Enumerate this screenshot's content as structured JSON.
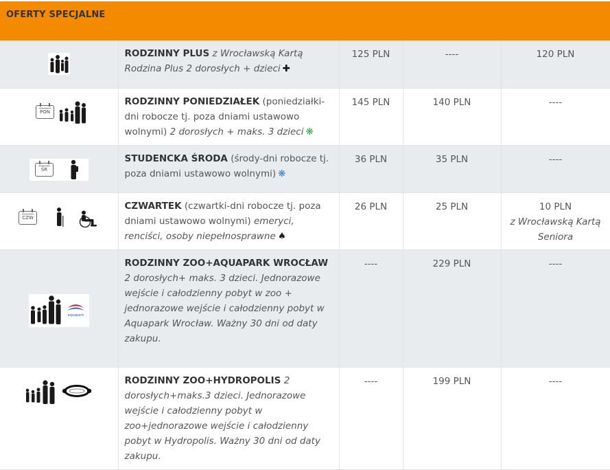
{
  "header": {
    "title": "OFERTY SPECJALNE"
  },
  "colors": {
    "header_bg": "#f38a00",
    "row_gray": "#e9ecef",
    "green_symbol": "#3aa74a",
    "blue_symbol": "#3b82c4"
  },
  "offers": [
    {
      "icons": [
        "family-silhouette-icon"
      ],
      "name": "RODZINNY PLUS",
      "rest": "",
      "italic": "z Wrocławską Kartą Rodzina Plus 2 dorosłych + dzieci",
      "symbol": "✚",
      "price1": "125 PLN",
      "price2": "----",
      "price3": "120 PLN",
      "price3_note": ""
    },
    {
      "icons": [
        "calendar-icon",
        "family-silhouette-icon"
      ],
      "calendar_label": "PON",
      "name": "RODZINNY PONIEDZIAŁEK",
      "rest": "(poniedziałki-dni robocze tj. poza dniami ustawowo wolnymi)",
      "italic": "2 dorosłych + maks. 3 dzieci",
      "symbol": "❋",
      "price1": "145 PLN",
      "price2": "140 PLN",
      "price3": "----",
      "price3_note": ""
    },
    {
      "icons": [
        "calendar-icon",
        "student-silhouette-icon"
      ],
      "calendar_label": "ŚR",
      "name": "STUDENCKA ŚRODA",
      "rest": "(środy-dni robocze tj. poza dniami ustawowo wolnymi)",
      "italic": "",
      "symbol": "❋",
      "price1": "36 PLN",
      "price2": "35 PLN",
      "price3": "----",
      "price3_note": ""
    },
    {
      "icons": [
        "calendar-icon",
        "senior-silhouette-icon",
        "wheelchair-icon"
      ],
      "calendar_label": "CZW",
      "name": "CZWARTEK",
      "rest": "(czwartki-dni robocze tj. poza dniami ustawowo wolnymi)",
      "italic": "emeryci, renciści, osoby niepełnosprawne",
      "symbol": "♠",
      "price1": "26 PLN",
      "price2": "25 PLN",
      "price3": "10 PLN",
      "price3_note": "z Wrocławską Kartą Seniora"
    },
    {
      "icons": [
        "family-silhouette-icon",
        "aquapark-logo"
      ],
      "aquapark_text": "aquapark",
      "name": "RODZINNY ZOO+AQUAPARK WROCŁAW",
      "rest": "",
      "italic": "2 dorosłych+ maks. 3 dzieci. Jednorazowe wejście i całodzienny pobyt w zoo + jednorazowe wejście i całodzienny pobyt w Aquapark Wrocław. Ważny 30 dni od daty zakupu.",
      "symbol": "",
      "price1": "----",
      "price2": "229 PLN",
      "price3": "----",
      "price3_note": ""
    },
    {
      "icons": [
        "family-silhouette-icon",
        "hydropolis-logo"
      ],
      "name": "RODZINNY ZOO+HYDROPOLIS",
      "rest": "",
      "italic": "2 dorosłych+maks.3 dzieci. Jednorazowe wejście i całodzienny pobyt w zoo+jednorazowe wejście i całodzienny pobyt w Hydropolis. Ważny 30 dni od daty zakupu.",
      "symbol": "",
      "price1": "----",
      "price2": "199 PLN",
      "price3": "----",
      "price3_note": ""
    }
  ]
}
